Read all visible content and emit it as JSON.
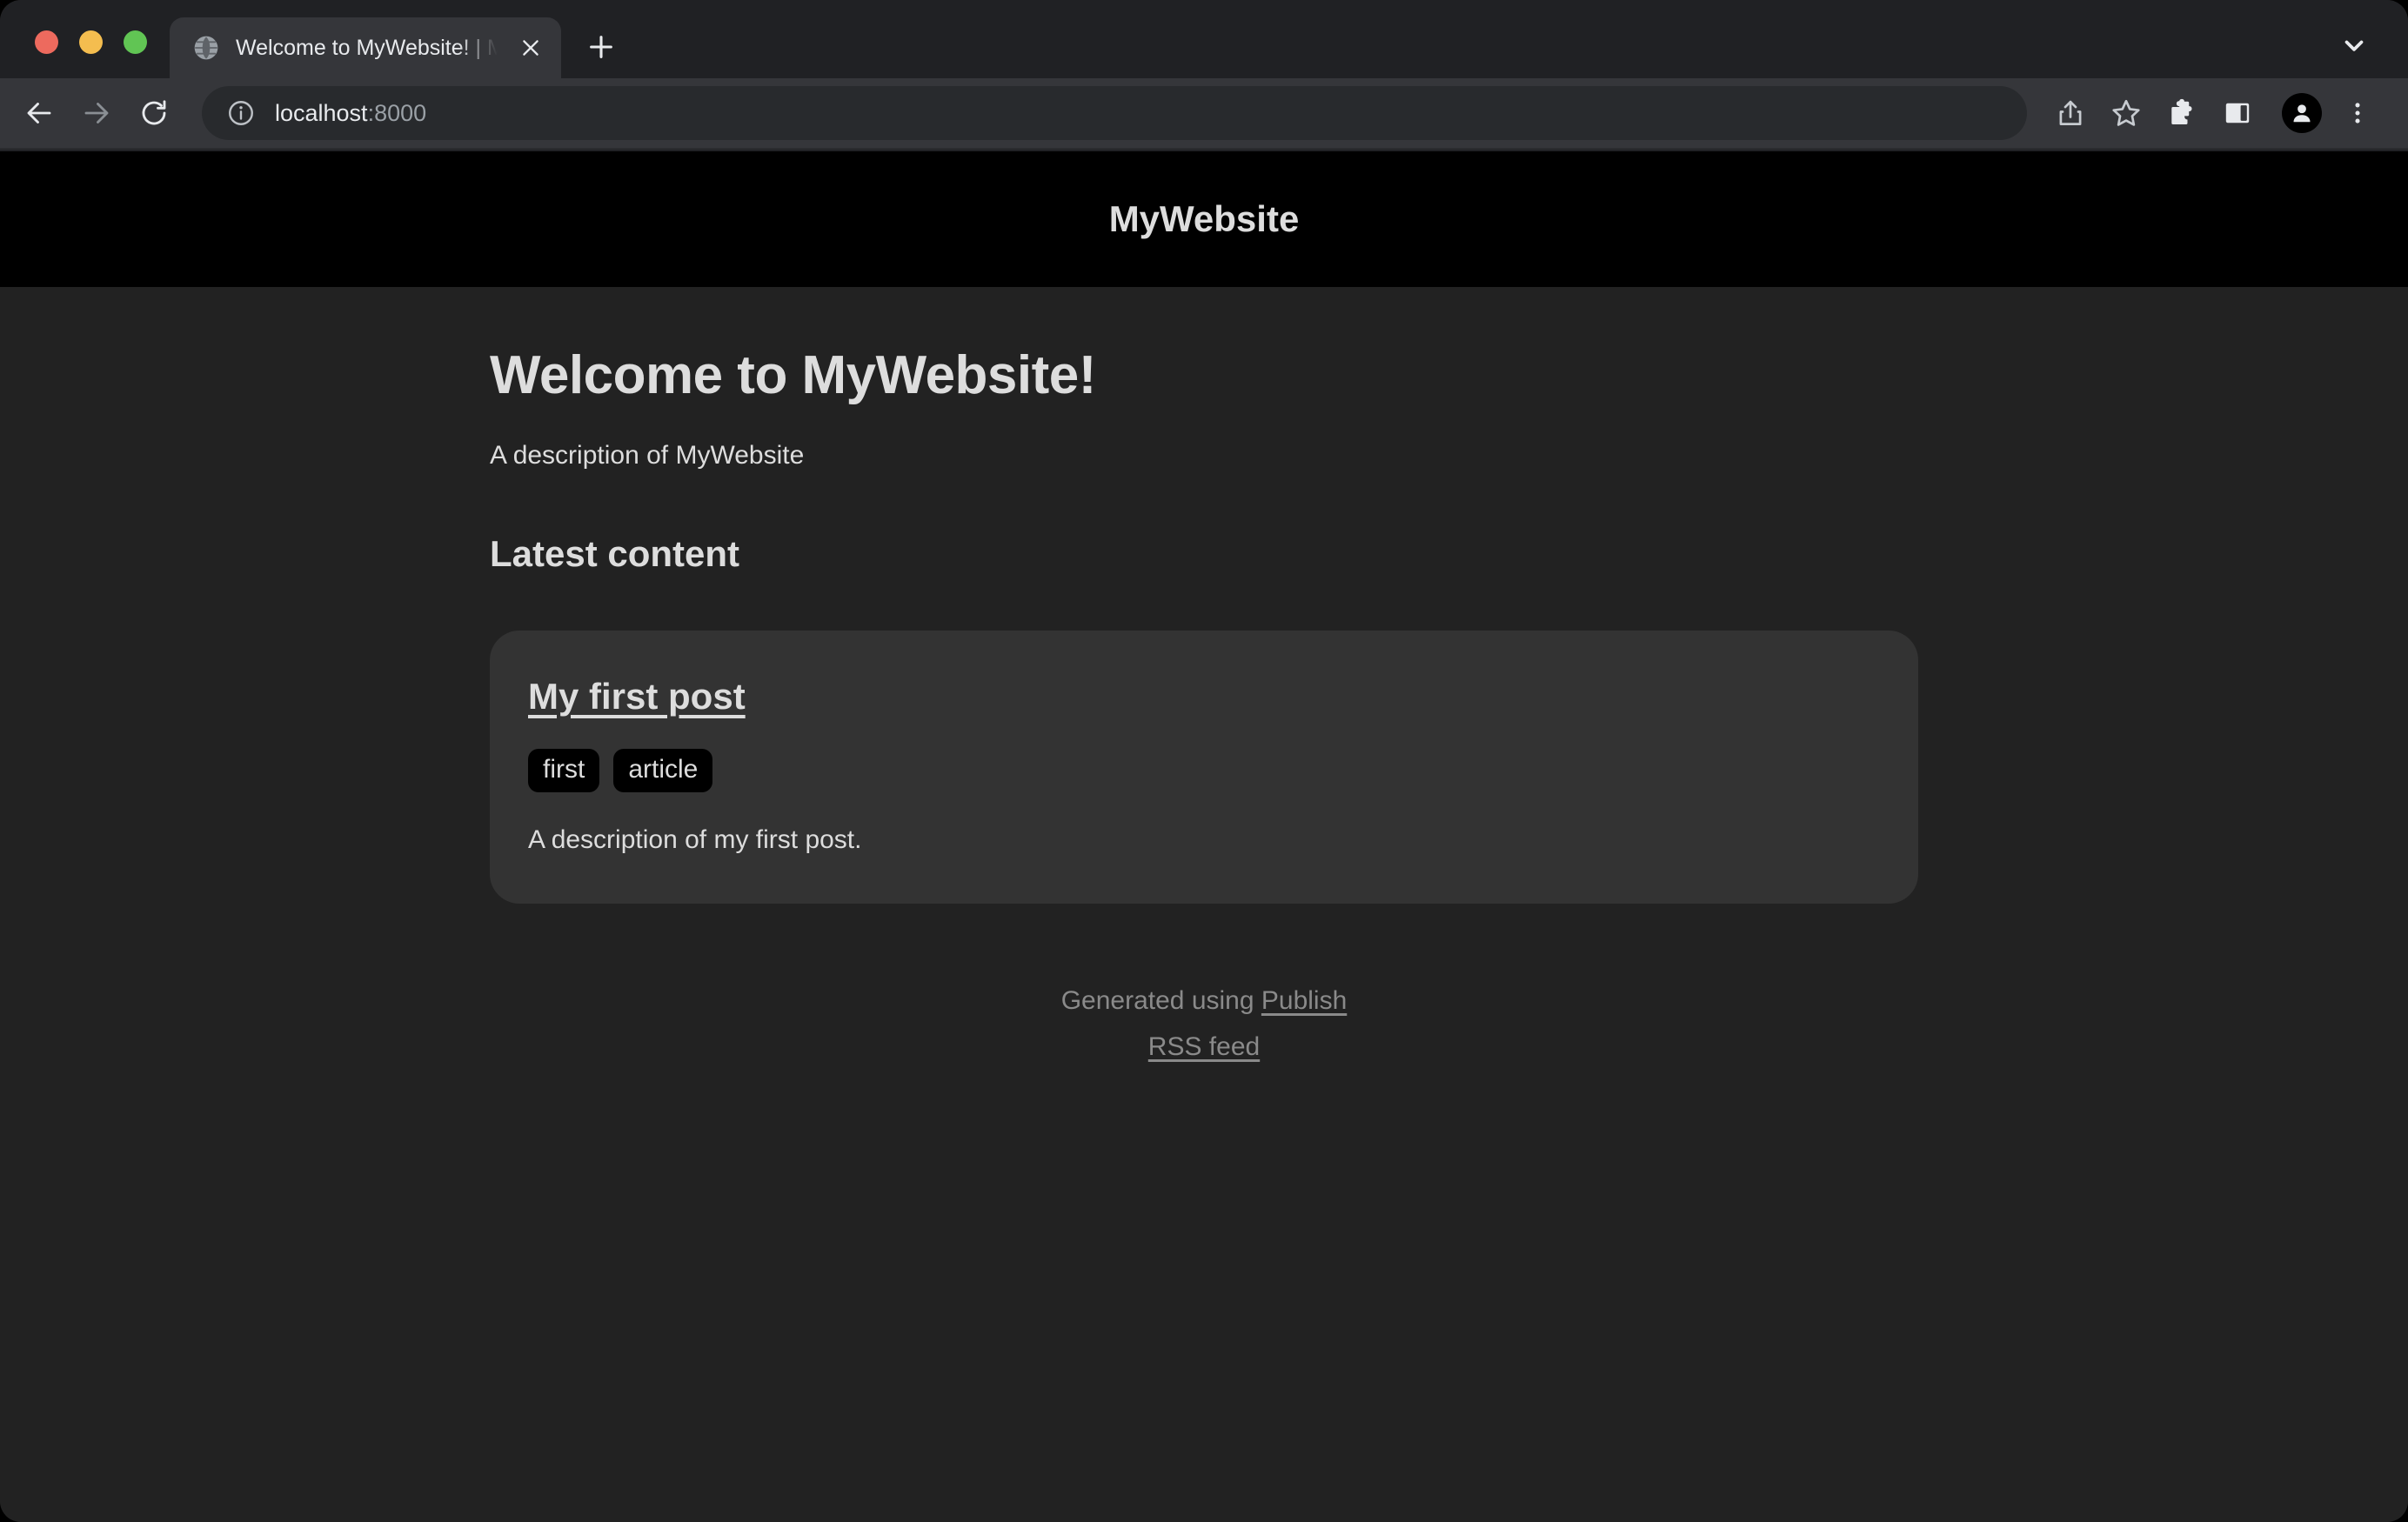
{
  "browser": {
    "window_controls": [
      {
        "name": "close",
        "color": "#ED6A5E"
      },
      {
        "name": "minimize",
        "color": "#F4BD4F"
      },
      {
        "name": "maximize",
        "color": "#61C554"
      }
    ],
    "tab": {
      "title": "Welcome to MyWebsite! | MyWebsite",
      "favicon": "globe-icon",
      "close_icon": "close-icon"
    },
    "new_tab_icon": "plus-icon",
    "tab_list_icon": "chevron-down-icon",
    "toolbar": {
      "back_icon": "arrow-left-icon",
      "forward_icon": "arrow-right-icon",
      "reload_icon": "reload-icon",
      "site_info_icon": "info-circle-icon",
      "url_host": "localhost",
      "url_port": ":8000",
      "url_full": "localhost:8000",
      "share_icon": "share-icon",
      "bookmark_icon": "star-icon",
      "extensions_icon": "puzzle-icon",
      "side_panel_icon": "side-panel-icon",
      "profile_icon": "person-icon",
      "menu_icon": "three-dots-vertical-icon"
    }
  },
  "site": {
    "header_title": "MyWebsite",
    "heading": "Welcome to MyWebsite!",
    "description": "A description of MyWebsite",
    "section_title": "Latest content",
    "items": [
      {
        "title": "My first post",
        "tags": [
          "first",
          "article"
        ],
        "description": "A description of my first post."
      }
    ],
    "footer": {
      "generated_prefix": "Generated using ",
      "generator_link": "Publish",
      "rss_link": "RSS feed"
    }
  },
  "colors": {
    "page_background": "#222222",
    "site_header_background": "#000000",
    "card_background": "#333333",
    "tag_background": "#000000",
    "text": "#DDDDDD",
    "muted_text": "#8A8A8A",
    "browser_toolbar": "#35363A",
    "browser_tabstrip": "#202124",
    "omnibox": "#282A2D"
  }
}
